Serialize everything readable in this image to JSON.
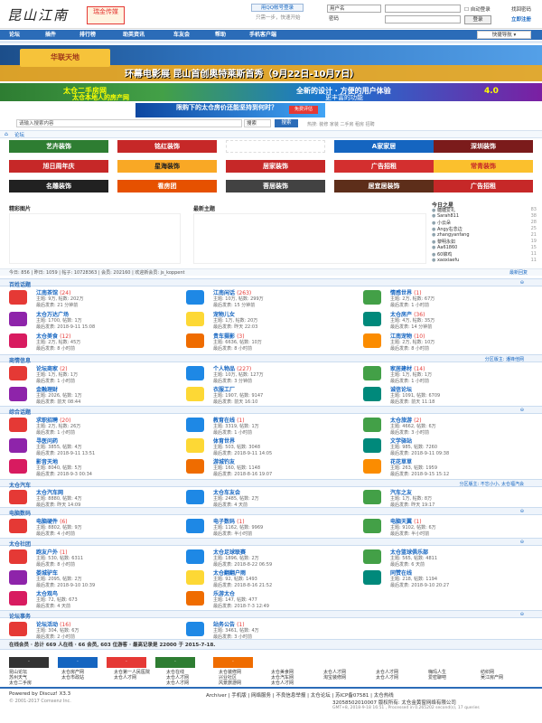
{
  "header": {
    "logo": "昆山江南",
    "logo2": "瑞金传媒",
    "qq_login": "用QQ帐号登录",
    "qq_hint": "只需一步，快速开始",
    "user_select": "用户名",
    "password_label": "密码",
    "auto_login": "自动登录",
    "login_button": "登录",
    "find_password": "找回密码",
    "register": "立即注册"
  },
  "nav": {
    "items": [
      "论坛",
      "插件",
      "排行榜",
      "助英资讯",
      "车友会",
      "帮助",
      "手机客户端"
    ],
    "quick_nav": "快捷导航"
  },
  "banners": {
    "b1_logo": "华联天地",
    "b1_text": "环幕电影展 昆山首创奥特莱斯首秀（9月22日-10月7日）",
    "b2_left1": "太仓二手房网",
    "b2_left2": "太仓本地人的房产网",
    "b2_mid1": "全新的设计 · 方便的用户体验",
    "b2_mid2": "更丰富的功能",
    "b2_right": "4.0",
    "b3_text": "限购下的太仓房价还能坚持到何时？",
    "b3_btn": "免费评估"
  },
  "search": {
    "placeholder": "请输入搜索内容",
    "select": "搜索",
    "button": "搜索",
    "hot": "热搜: 装修 家装 二手房 租房 招聘"
  },
  "breadcrumb": "论坛",
  "ads": [
    {
      "label": "艺卉装饰",
      "color": "#2e7d32"
    },
    {
      "label": "铭红装饰",
      "color": "#c62828"
    },
    {
      "label": "",
      "color": "#fff"
    },
    {
      "label": "A家家居",
      "color": "#1565c0"
    },
    {
      "label": "深圳装饰",
      "color": "#7b1b1b"
    },
    {
      "label": "旭日周年庆",
      "color": "#c62828"
    },
    {
      "label": "星海装饰",
      "color": "#f9a825"
    },
    {
      "label": "居家装饰",
      "color": "#c62828"
    },
    {
      "label": "广告招租",
      "color": "#d32f2f"
    },
    {
      "label": "常青装饰",
      "color": "#fbc02d"
    },
    {
      "label": "名雕装饰",
      "color": "#212121"
    },
    {
      "label": "看房团",
      "color": "#e65100"
    },
    {
      "label": "菩居装饰",
      "color": "#424242"
    },
    {
      "label": "居宜居装饰",
      "color": "#5d2e1a"
    },
    {
      "label": "广告招租",
      "color": "#c62828"
    }
  ],
  "featured": {
    "pics_title": "精彩图片",
    "topics_title": "最新主题"
  },
  "rank": {
    "title": "今日之星",
    "rows": [
      {
        "name": "糖糖爱礼",
        "n": "83"
      },
      {
        "name": "Sarah811",
        "n": "38"
      },
      {
        "name": "小云朵",
        "n": "28"
      },
      {
        "name": "Angy右念边",
        "n": "25"
      },
      {
        "name": "zhangyanfang",
        "n": "21"
      },
      {
        "name": "黎明永如",
        "n": "19"
      },
      {
        "name": "Aa61860",
        "n": "15"
      },
      {
        "name": "60锦鸡",
        "n": "11"
      },
      {
        "name": "xaoxiaefu",
        "n": "11"
      }
    ]
  },
  "stats": {
    "text": "今日: 856 | 昨日: 1059 | 帖子: 10728363 | 会员: 202160 | 欢迎新会员: js_koppent",
    "latest": "最新回复"
  },
  "sections": {
    "s1": "百姓话题",
    "s2": "商情信息",
    "s2r": "分区版主: 潘锋他网",
    "s3": "综合话题",
    "s4": "太仓汽车",
    "s4r": "分区版主: 不忘小小, 太仓福汽会",
    "s5": "电脑数码",
    "s6": "太仓社团",
    "s7": "论坛事务"
  },
  "forums_s1": [
    {
      "name": "江南茶馆",
      "new": "(24)",
      "stat": "主题: 9万, 帖数: 202万",
      "last": "最后发表: 21 分钟前"
    },
    {
      "name": "江南闲话",
      "new": "(263)",
      "stat": "主题: 10万, 帖数: 299万",
      "last": "最后发表: 15 分钟前"
    },
    {
      "name": "情感世界",
      "new": "(1)",
      "stat": "主题: 2万, 帖数: 67万",
      "last": "最后发表: 1 小时前"
    },
    {
      "name": "太仓万达广场",
      "new": "",
      "stat": "主题: 1700, 帖数: 1万",
      "last": "最后发表: 2018-9-11 15:08"
    },
    {
      "name": "宠物儿女",
      "new": "",
      "stat": "主题: 1万, 帖数: 20万",
      "last": "最后发表: 昨天 22:03"
    },
    {
      "name": "太仓房产",
      "new": "(36)",
      "stat": "主题: 4万, 帖数: 35万",
      "last": "最后发表: 14 分钟前"
    },
    {
      "name": "太仓美食",
      "new": "(12)",
      "stat": "主题: 2万, 帖数: 45万",
      "last": "最后发表: 8 小时前"
    },
    {
      "name": "贵车摄影",
      "new": "(3)",
      "stat": "主题: 6636, 帖数: 10万",
      "last": "最后发表: 8 小时前"
    },
    {
      "name": "江南宠物",
      "new": "(10)",
      "stat": "主题: 2万, 帖数: 10万",
      "last": "最后发表: 8 小时前"
    }
  ],
  "forums_s2": [
    {
      "name": "论坛商家",
      "new": "(2)",
      "stat": "主题: 1万, 帖数: 1万",
      "last": "最后发表: 1 小时前"
    },
    {
      "name": "个人物品",
      "new": "(227)",
      "stat": "主题: 10万, 帖数: 127万",
      "last": "最后发表: 3 分钟前"
    },
    {
      "name": "家居建材",
      "new": "(14)",
      "stat": "主题: 1万, 帖数: 1万",
      "last": "最后发表: 1 小时前"
    },
    {
      "name": "金融理财",
      "new": "",
      "stat": "主题: 2026, 帖数: 1万",
      "last": "最后发表: 前天 08:44"
    },
    {
      "name": "衣服工厂",
      "new": "",
      "stat": "主题: 1907, 帖数: 9147",
      "last": "最后发表: 前天 16:10"
    },
    {
      "name": "诚信论坛",
      "new": "",
      "stat": "主题: 1091, 帖数: 6709",
      "last": "最后发表: 前天 11:18"
    }
  ],
  "forums_s3": [
    {
      "name": "求职招聘",
      "new": "(20)",
      "stat": "主题: 2万, 帖数: 26万",
      "last": "最后发表: 1 小时前"
    },
    {
      "name": "教育在线",
      "new": "(1)",
      "stat": "主题: 3319, 帖数: 1万",
      "last": "最后发表: 1 小时前"
    },
    {
      "name": "太仓旅游",
      "new": "(2)",
      "stat": "主题: 4662, 帖数: 6万",
      "last": "最后发表: 3 小时前"
    },
    {
      "name": "寻医问药",
      "new": "",
      "stat": "主题: 3855, 帖数: 4万",
      "last": "最后发表: 2018-9-11 13:51"
    },
    {
      "name": "体育世界",
      "new": "",
      "stat": "主题: 503, 帖数: 3048",
      "last": "最后发表: 2018-9-11 14:05"
    },
    {
      "name": "文学驿站",
      "new": "",
      "stat": "主题: 985, 帖数: 7260",
      "last": "最后发表: 2018-9-11 09:38"
    },
    {
      "name": "影音天地",
      "new": "",
      "stat": "主题: 8040, 帖数: 5万",
      "last": "最后发表: 2018-9-3 00:34"
    },
    {
      "name": "游城钓友",
      "new": "",
      "stat": "主题: 160, 帖数: 1148",
      "last": "最后发表: 2018-8-16 19:07"
    },
    {
      "name": "花花草草",
      "new": "",
      "stat": "主题: 263, 帖数: 1959",
      "last": "最后发表: 2018-9-15 15:12"
    }
  ],
  "forums_s4": [
    {
      "name": "太仓汽车网",
      "new": "",
      "stat": "主题: 8880, 帖数: 4万",
      "last": "最后发表: 昨天 14:09"
    },
    {
      "name": "太仓车友会",
      "new": "",
      "stat": "主题: 2485, 帖数: 2万",
      "last": "最后发表: 4 天前"
    },
    {
      "name": "汽车之友",
      "new": "",
      "stat": "主题: 1万, 帖数: 8万",
      "last": "最后发表: 昨天 19:17"
    }
  ],
  "forums_s5": [
    {
      "name": "电脑硬件",
      "new": "(6)",
      "stat": "主题: 8802, 帖数: 9万",
      "last": "最后发表: 4 小时前"
    },
    {
      "name": "电子数码",
      "new": "(1)",
      "stat": "主题: 1162, 帖数: 9969",
      "last": "最后发表: 半小时前"
    },
    {
      "name": "电脑天翼",
      "new": "(1)",
      "stat": "主题: 9102, 帖数: 6万",
      "last": "最后发表: 半小时前"
    }
  ],
  "forums_s6": [
    {
      "name": "跑友户外",
      "new": "(1)",
      "stat": "主题: 530, 帖数: 6311",
      "last": "最后发表: 8 小时前"
    },
    {
      "name": "太仓足球联赛",
      "new": "",
      "stat": "主题: 1896, 帖数: 2万",
      "last": "最后发表: 2018-8-22 06:59"
    },
    {
      "name": "太仓篮球俱乐部",
      "new": "",
      "stat": "主题: 565, 帖数: 4811",
      "last": "最后发表: 6 天前"
    },
    {
      "name": "娄城驴车",
      "new": "",
      "stat": "主题: 2095, 帖数: 2万",
      "last": "最后发表: 2018-9-10 10:39"
    },
    {
      "name": "太仓翻翻户雨",
      "new": "",
      "stat": "主题: 92, 帖数: 1493",
      "last": "最后发表: 2018-8-16 21:52"
    },
    {
      "name": "同赞在线",
      "new": "",
      "stat": "主题: 218, 帖数: 1194",
      "last": "最后发表: 2018-9-10 20:27"
    },
    {
      "name": "太仓观鸟",
      "new": "",
      "stat": "主题: 72, 帖数: 673",
      "last": "最后发表: 4 天前"
    },
    {
      "name": "乐游太仓",
      "new": "",
      "stat": "主题: 147, 帖数: 477",
      "last": "最后发表: 2018-7-3 12:49"
    }
  ],
  "forums_s7": [
    {
      "name": "论坛活动",
      "new": "(16)",
      "stat": "主题: 304, 帖数: 6万",
      "last": "最后发表: 2 小时前"
    },
    {
      "name": "站务公告",
      "new": "(1)",
      "stat": "主题: 3461, 帖数: 4万",
      "last": "最后发表: 3 小时前"
    }
  ],
  "online": "在线会员 · 总计 669 人在线 · 66 会员, 603 位游客 · 最高记录是 22000 于 2015-7-18.",
  "links": {
    "cols": [
      [
        "昆山论坛",
        "苏州天气",
        "太仓二手房"
      ],
      [
        "太仓房产网",
        "太仓市政站",
        ""
      ],
      [
        "太仓第一人民医院",
        "太仓人才网",
        ""
      ],
      [
        "太仓在线",
        "太仓人才网",
        "太仓人才网"
      ],
      [
        "太仓装修网",
        "兴业社区",
        "风景旅游网"
      ],
      [
        "太仓美食网",
        "太仓汽车网",
        "太仓人才网"
      ],
      [
        "太仓人才网",
        "淘宝装修网",
        ""
      ],
      [
        "太仓人才网",
        "太仓人才网",
        ""
      ],
      [
        "嗨玛人生",
        "爱密聊吧",
        ""
      ],
      [
        "纺织网",
        "吴江房产网",
        ""
      ]
    ]
  },
  "footer": {
    "powered": "Powered by Discuz! X3.3",
    "copy": "© 2001-2017 Comsenz Inc.",
    "links": "Archiver | 手机版 | 网络服务 | 不良信息举报 | 太仓论坛 | 苏ICP备07581 | 太仓热线",
    "icp": "32058502010007  版权所有: 太仓金黄窗网络有限公司",
    "gmt": "GMT+8, 2018-9-18 16:51 , Processed in 0.265202 second(s), 17 queries"
  }
}
